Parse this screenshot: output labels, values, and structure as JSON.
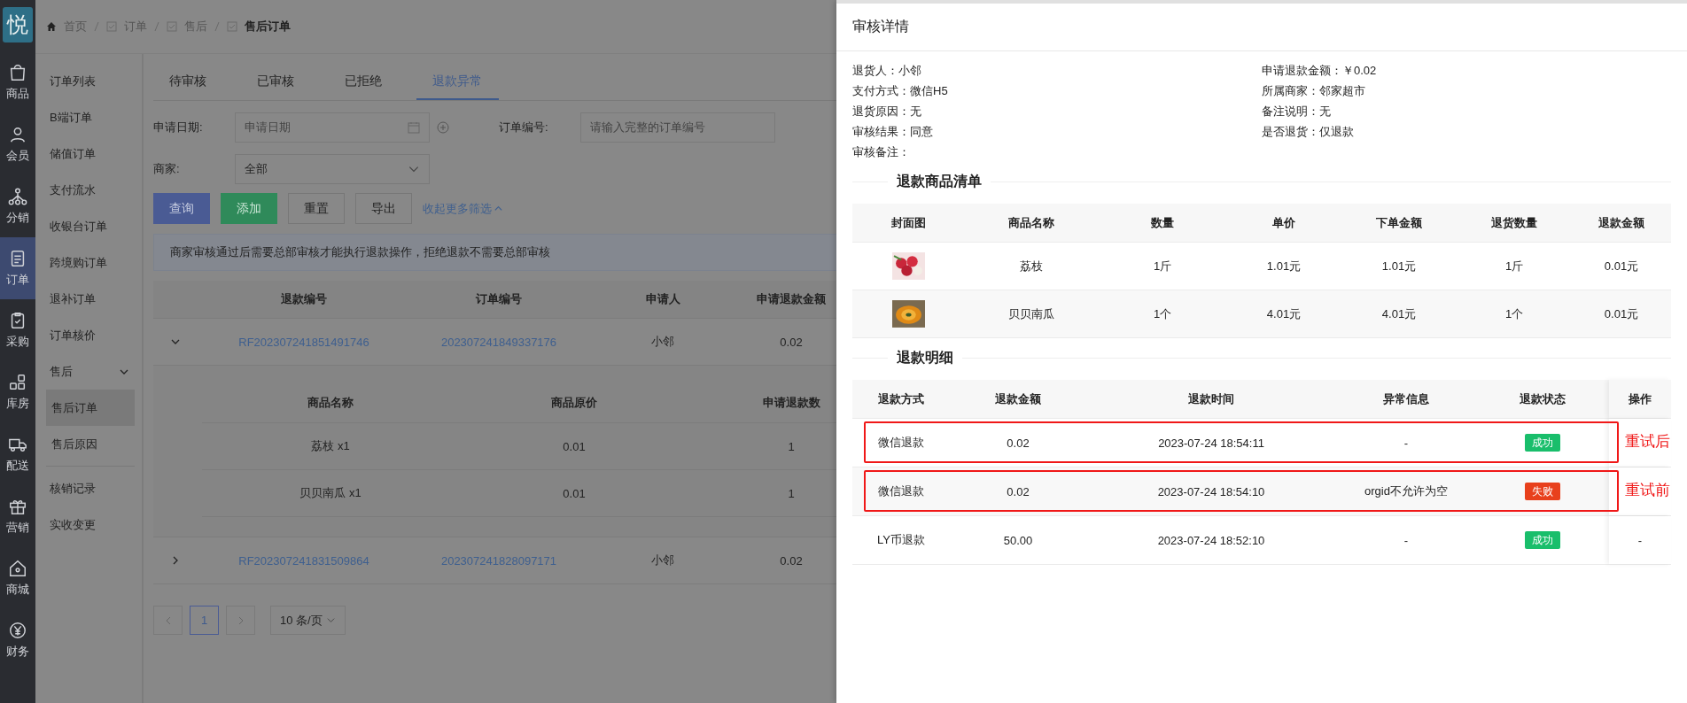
{
  "rail": {
    "logo": "悦",
    "items": [
      {
        "label": "商品",
        "selected": false
      },
      {
        "label": "会员",
        "selected": false
      },
      {
        "label": "分销",
        "selected": false
      },
      {
        "label": "订单",
        "selected": true
      },
      {
        "label": "采购",
        "selected": false
      },
      {
        "label": "库房",
        "selected": false
      },
      {
        "label": "配送",
        "selected": false
      },
      {
        "label": "营销",
        "selected": false
      },
      {
        "label": "商城",
        "selected": false
      },
      {
        "label": "财务",
        "selected": false
      }
    ]
  },
  "breadcrumb": [
    "首页",
    "订单",
    "售后",
    "售后订单"
  ],
  "submenu": [
    {
      "label": "订单列表",
      "selected": false
    },
    {
      "label": "B端订单",
      "selected": false
    },
    {
      "label": "储值订单",
      "selected": false
    },
    {
      "label": "支付流水",
      "selected": false
    },
    {
      "label": "收银台订单",
      "selected": false
    },
    {
      "label": "跨境购订单",
      "selected": false
    },
    {
      "label": "退补订单",
      "selected": false
    },
    {
      "label": "订单核价",
      "selected": false
    },
    {
      "label": "售后",
      "selected": false,
      "expanded": true,
      "children": [
        {
          "label": "售后订单",
          "selected": true
        },
        {
          "label": "售后原因",
          "selected": false
        }
      ]
    },
    {
      "label": "核销记录",
      "selected": false,
      "divider": true
    },
    {
      "label": "实收变更",
      "selected": false
    }
  ],
  "tabs": [
    {
      "label": "待审核",
      "selected": false
    },
    {
      "label": "已审核",
      "selected": false
    },
    {
      "label": "已拒绝",
      "selected": false
    },
    {
      "label": "退款异常",
      "selected": true
    }
  ],
  "filters": {
    "date_label": "申请日期:",
    "date_placeholder": "申请日期",
    "order_label": "订单编号:",
    "order_placeholder": "请输入完整的订单编号",
    "merchant_label": "商家:",
    "merchant_value": "全部"
  },
  "buttons": [
    {
      "label": "查询",
      "kind": "primary"
    },
    {
      "label": "添加",
      "kind": "success"
    },
    {
      "label": "重置",
      "kind": "default"
    },
    {
      "label": "导出",
      "kind": "default"
    }
  ],
  "collapse_link": "收起更多筛选",
  "notice": "商家审核通过后需要总部审核才能执行退款操作，拒绝退款不需要总部审核",
  "table": {
    "columns": [
      "退款编号",
      "订单编号",
      "申请人",
      "申请退款金额"
    ],
    "sub_columns": [
      "商品名称",
      "商品原价",
      "申请退款数"
    ],
    "rows": [
      {
        "expanded": true,
        "refund_no": "RF202307241851491746",
        "order_no": "202307241849337176",
        "applicant": "小邻",
        "amount": "0.02",
        "items": [
          [
            "荔枝 x1",
            "0.01",
            "1"
          ],
          [
            "贝贝南瓜 x1",
            "0.01",
            "1"
          ]
        ]
      },
      {
        "expanded": false,
        "refund_no": "RF202307241831509864",
        "order_no": "202307241828097171",
        "applicant": "小邻",
        "amount": "0.02"
      }
    ]
  },
  "pagination": {
    "page": "1",
    "page_size": "10 条/页"
  },
  "drawer": {
    "title": "审核详情",
    "info_left": [
      {
        "label": "退货人：",
        "value": "小邻"
      },
      {
        "label": "支付方式：",
        "value": "微信H5"
      },
      {
        "label": "退货原因：",
        "value": "无"
      },
      {
        "label": "审核结果：",
        "value": "同意"
      },
      {
        "label": "审核备注："
      }
    ],
    "info_right": [
      {
        "label": "申请退款金额：",
        "value": "￥0.02"
      },
      {
        "label": "所属商家：",
        "value": "邻家超市"
      },
      {
        "label": "备注说明：",
        "value": "无"
      },
      {
        "label": "是否退货：",
        "value": "仅退款"
      }
    ],
    "goods_title": "退款商品清单",
    "goods_columns": [
      "封面图",
      "商品名称",
      "数量",
      "单价",
      "下单金额",
      "退货数量",
      "退款金额"
    ],
    "goods": [
      {
        "cells": [
          "荔枝",
          "1斤",
          "1.01元",
          "1.01元",
          "1斤",
          "0.01元"
        ]
      },
      {
        "cells": [
          "贝贝南瓜",
          "1个",
          "4.01元",
          "4.01元",
          "1个",
          "0.01元"
        ]
      }
    ],
    "refund_title": "退款明细",
    "refund_columns": [
      "退款方式",
      "退款金额",
      "退款时间",
      "异常信息",
      "退款状态",
      "操作"
    ],
    "refunds": [
      {
        "method": "微信退款",
        "amount": "0.02",
        "time": "2023-07-24 18:54:11",
        "error": "-",
        "status": "成功",
        "kind": "success",
        "annotation": "重试后"
      },
      {
        "method": "微信退款",
        "amount": "0.02",
        "time": "2023-07-24 18:54:10",
        "error": "orgid不允许为空",
        "status": "失败",
        "kind": "fail",
        "annotation": "重试前"
      },
      {
        "method": "LY币退款",
        "amount": "50.00",
        "time": "2023-07-24 18:52:10",
        "error": "-",
        "status": "成功",
        "kind": "success",
        "action": "-"
      }
    ]
  }
}
